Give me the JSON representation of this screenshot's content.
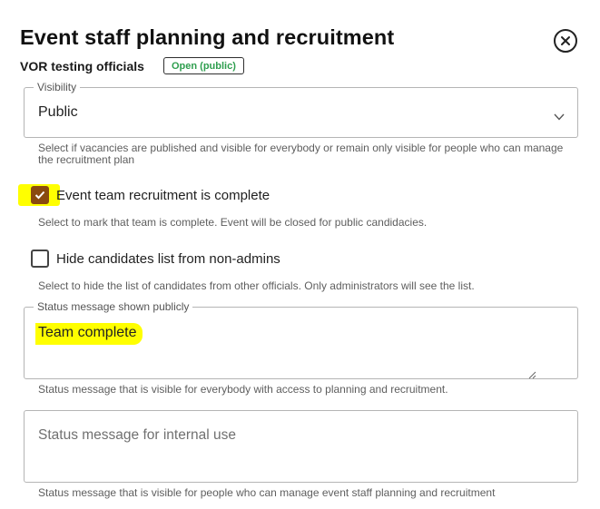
{
  "dialog": {
    "title": "Event staff planning and recruitment",
    "subtitle": "VOR testing officials",
    "status_badge": "Open (public)",
    "status_badge_color": "#2e9e4e"
  },
  "visibility": {
    "legend": "Visibility",
    "value": "Public",
    "helper": "Select if vacancies are published and visible for everybody or remain only visible for people who can manage the recruitment plan"
  },
  "team_complete": {
    "label": "Event team recruitment is complete",
    "checked": true,
    "helper": "Select to mark that team is complete. Event will be closed for public candidacies.",
    "checkbox_color": "#8a4a0f"
  },
  "hide_candidates": {
    "label": "Hide candidates list from non-admins",
    "checked": false,
    "helper": "Select to hide the list of candidates from other officials. Only administrators will see the list."
  },
  "public_status": {
    "legend": "Status message shown publicly",
    "value": "Team complete",
    "helper": "Status message that is visible for everybody with access to planning and recruitment."
  },
  "internal_status": {
    "placeholder": "Status message for internal use",
    "helper": "Status message that is visible for people who can manage event staff planning and recruitment"
  },
  "icons": {
    "close": "close-icon",
    "dropdown": "chevron-down-icon",
    "check": "check-icon",
    "resize": "resize-handle-icon"
  },
  "highlight_color": "#ffff00"
}
